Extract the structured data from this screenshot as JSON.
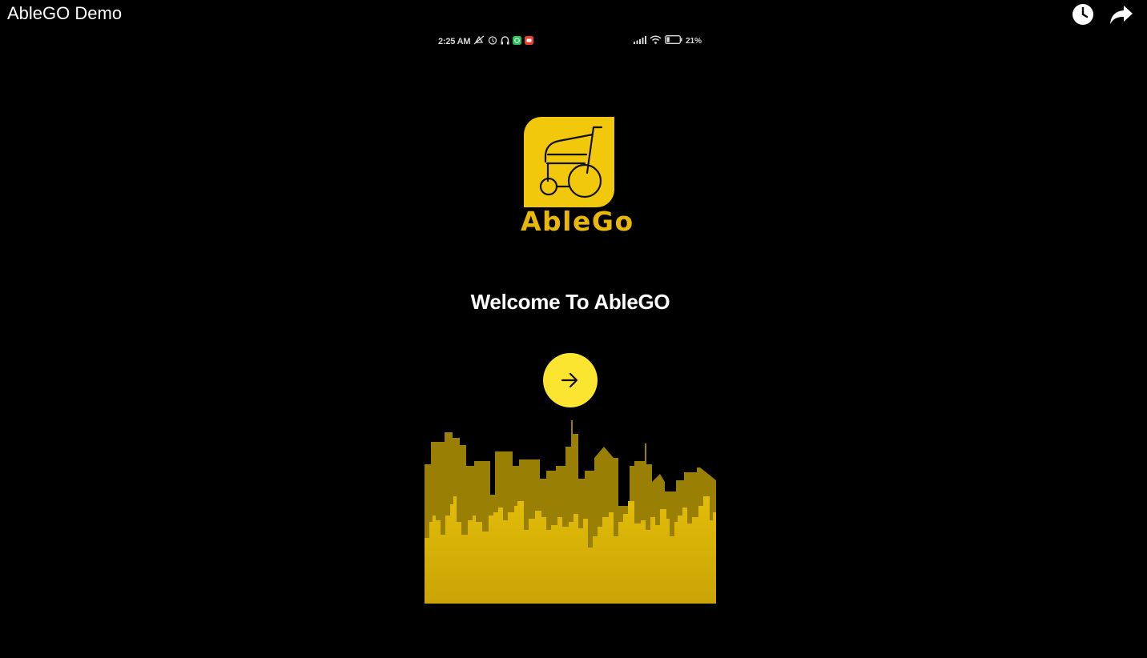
{
  "video": {
    "title": "AbleGO Demo",
    "actions": [
      {
        "name": "watch-later-icon"
      },
      {
        "name": "share-icon"
      }
    ]
  },
  "status_bar": {
    "time": "2:25 AM",
    "battery": "21%",
    "left_icons": [
      "silent-icon",
      "alarm-icon",
      "headset-icon",
      "whatsapp-icon",
      "notification-app-icon"
    ],
    "right_icons": [
      "signal-icon",
      "wifi-icon",
      "battery-icon"
    ]
  },
  "app": {
    "logo_text": "AbleGo",
    "logo_icon": "wheelchair-icon",
    "welcome": "Welcome To AbleGO",
    "next_icon": "arrow-right-icon"
  },
  "colors": {
    "background": "#000000",
    "logo_tile": "#f2c80c",
    "logo_text": "#e8b70a",
    "button": "#fbe530",
    "skyline_back": "#9a7f05",
    "skyline_front": "#d4ad08"
  }
}
